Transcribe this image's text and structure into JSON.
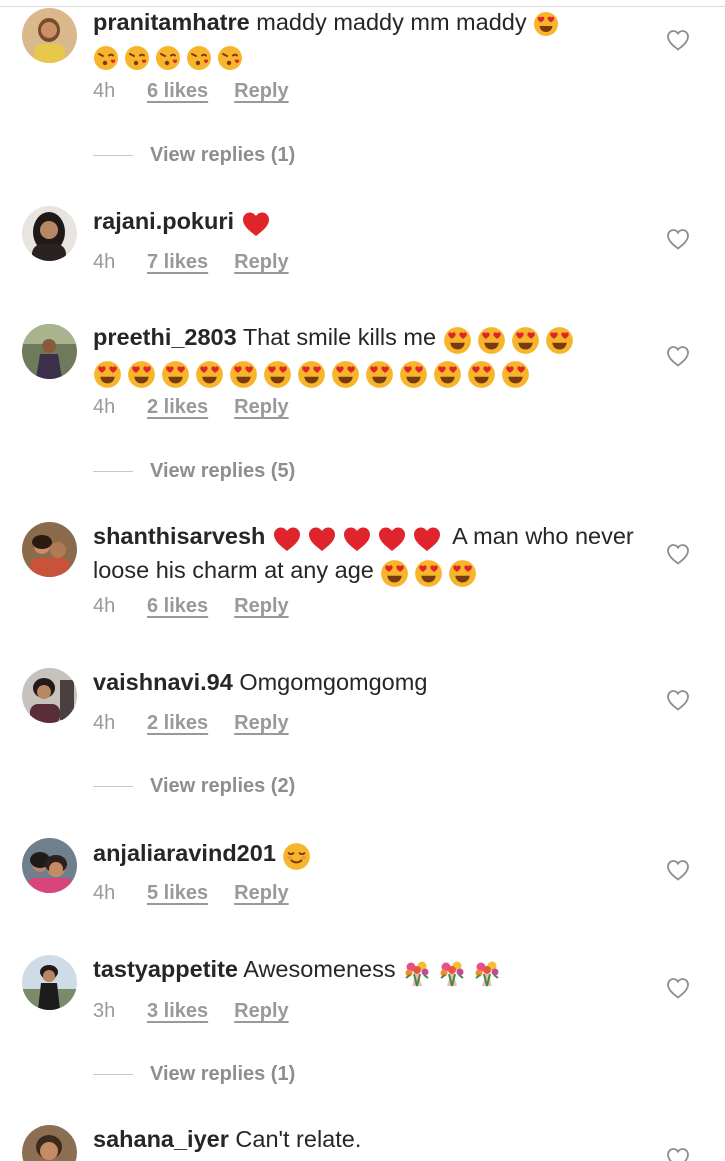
{
  "colors": {
    "text": "#262626",
    "meta": "#999999",
    "view_replies": "#8e8e8e",
    "heart_emoji": "#e0242b",
    "face_emoji": "#f7b52b"
  },
  "comments": [
    {
      "username": "pranitamhatre",
      "text": "maddy maddy mm maddy",
      "emojis": [
        "heart-eyes",
        "kissing-heart",
        "kissing-heart",
        "kissing-heart",
        "kissing-heart",
        "kissing-heart"
      ],
      "time": "4h",
      "likes": "6 likes",
      "reply": "Reply",
      "view_replies": "View replies (1)"
    },
    {
      "username": "rajani.pokuri",
      "text": "",
      "emojis": [
        "red-heart"
      ],
      "time": "4h",
      "likes": "7 likes",
      "reply": "Reply"
    },
    {
      "username": "preethi_2803",
      "text": "That smile kills me",
      "emojis": [
        "heart-eyes",
        "heart-eyes",
        "heart-eyes",
        "heart-eyes",
        "heart-eyes",
        "heart-eyes",
        "heart-eyes",
        "heart-eyes",
        "heart-eyes",
        "heart-eyes",
        "heart-eyes",
        "heart-eyes",
        "heart-eyes",
        "heart-eyes",
        "heart-eyes",
        "heart-eyes",
        "heart-eyes"
      ],
      "time": "4h",
      "likes": "2 likes",
      "reply": "Reply",
      "view_replies": "View replies (5)"
    },
    {
      "username": "shanthisarvesh",
      "text": "A man who never loose his  charm at any age",
      "emojis_before": [
        "red-heart",
        "red-heart",
        "red-heart",
        "red-heart",
        "red-heart"
      ],
      "emojis": [
        "heart-eyes",
        "heart-eyes",
        "heart-eyes"
      ],
      "time": "4h",
      "likes": "6 likes",
      "reply": "Reply"
    },
    {
      "username": "vaishnavi.94",
      "text": "Omgomgomgomg",
      "emojis": [],
      "time": "4h",
      "likes": "2 likes",
      "reply": "Reply",
      "view_replies": "View replies (2)"
    },
    {
      "username": "anjaliaravind201",
      "text": "",
      "emojis": [
        "relieved-face"
      ],
      "time": "4h",
      "likes": "5 likes",
      "reply": "Reply"
    },
    {
      "username": "tastyappetite",
      "text": "Awesomeness",
      "emojis": [
        "bouquet",
        "bouquet",
        "bouquet"
      ],
      "time": "3h",
      "likes": "3 likes",
      "reply": "Reply",
      "view_replies": "View replies (1)"
    },
    {
      "username": "sahana_iyer",
      "text": "Can't relate.",
      "emojis": []
    }
  ]
}
